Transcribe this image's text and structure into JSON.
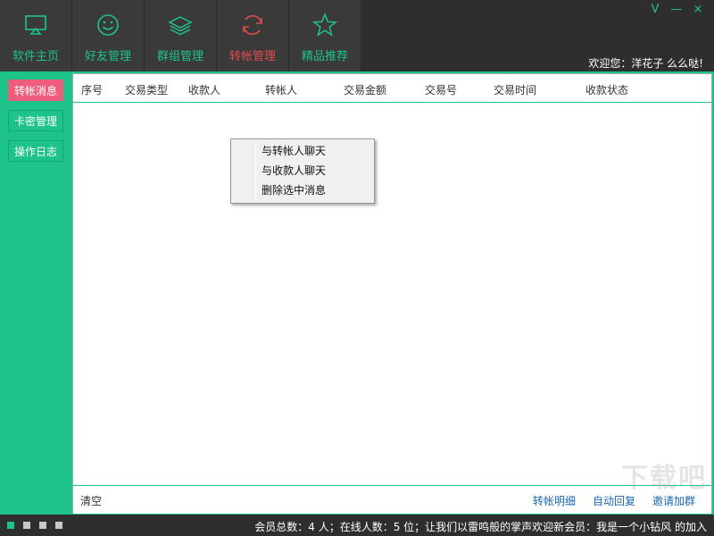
{
  "nav": {
    "items": [
      {
        "label": "软件主页",
        "icon": "monitor-icon"
      },
      {
        "label": "好友管理",
        "icon": "smiley-icon"
      },
      {
        "label": "群组管理",
        "icon": "layers-icon"
      },
      {
        "label": "转帐管理",
        "icon": "refresh-icon",
        "active": true
      },
      {
        "label": "精品推荐",
        "icon": "star-icon"
      }
    ]
  },
  "window": {
    "minimize": "V",
    "min_dash": "—",
    "close": "×"
  },
  "welcome": "欢迎您：洋花子 么么哒!",
  "sidebar": {
    "items": [
      {
        "label": "转帐消息",
        "active": true
      },
      {
        "label": "卡密管理"
      },
      {
        "label": "操作日志"
      }
    ]
  },
  "table": {
    "columns": [
      "序号",
      "交易类型",
      "收款人",
      "转帐人",
      "交易金额",
      "交易号",
      "交易时间",
      "收款状态"
    ]
  },
  "context_menu": {
    "items": [
      "与转帐人聊天",
      "与收款人聊天",
      "删除选中消息"
    ]
  },
  "footer": {
    "clear": "清空",
    "links": [
      "转帐明细",
      "自动回复",
      "邀请加群"
    ]
  },
  "status": {
    "text": "会员总数：4 人；在线人数：5 位；让我们以雷鸣般的掌声欢迎新会员：我是一个小钻风 的加入"
  },
  "watermark": "下载吧",
  "colors": {
    "accent": "#1ec38a",
    "active_nav": "#e24c4c",
    "active_side": "#ef5d7c",
    "link": "#1a67b0"
  }
}
